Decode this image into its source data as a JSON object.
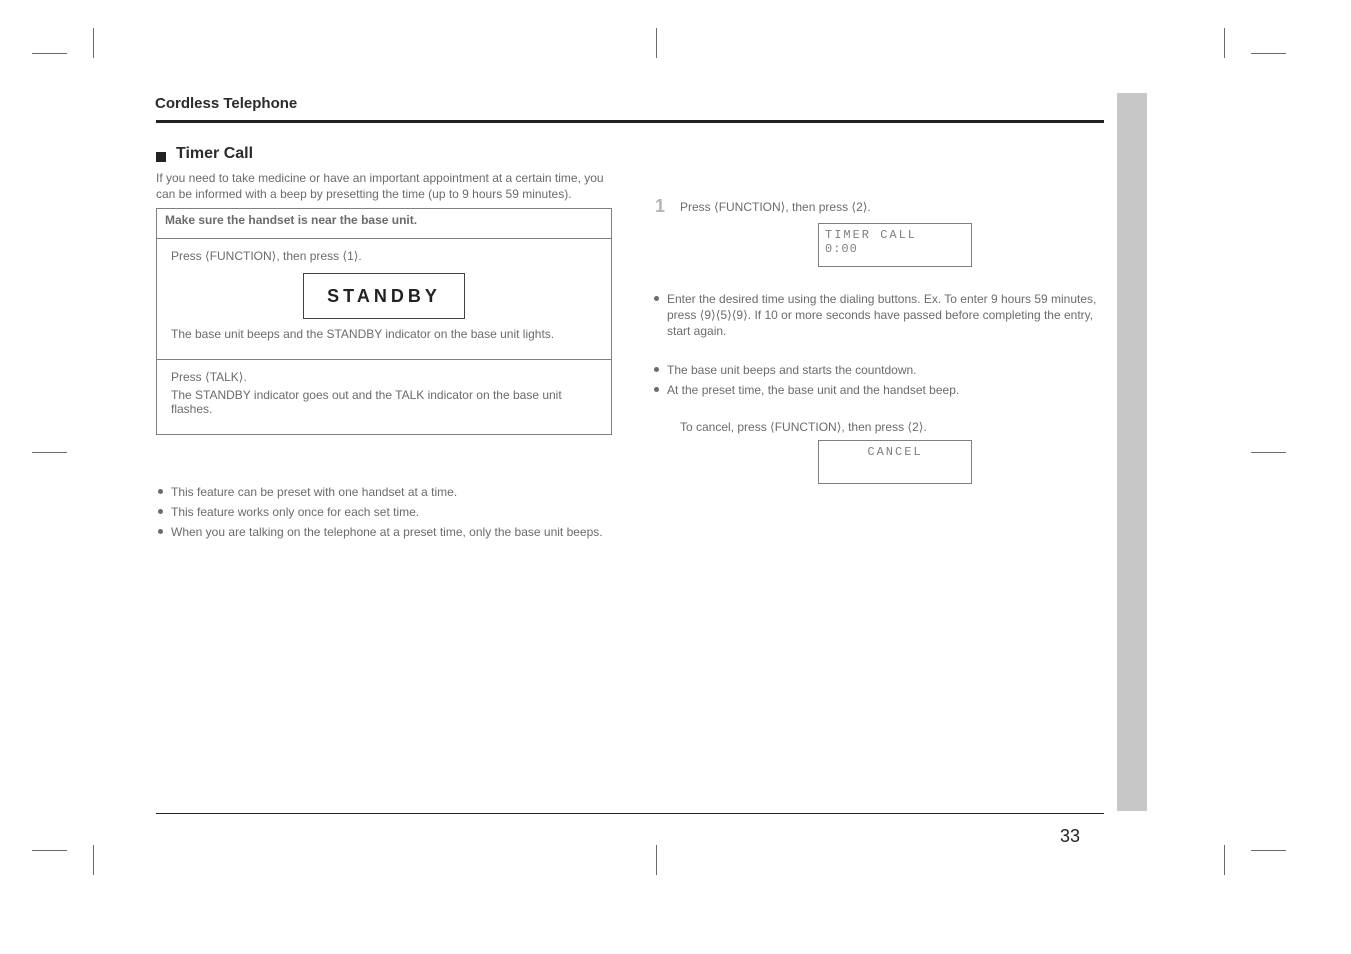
{
  "page": {
    "number": "33",
    "section_title": "Cordless Telephone",
    "headline": "Timer Call",
    "intro": "If you need to take medicine or have an important appointment at a certain time, you can be informed with a beep by presetting the time (up to 9 hours 59 minutes).",
    "bullets_after_box": [
      "This feature can be preset with one handset at a time.",
      "This feature works only once for each set time.",
      "When you are talking on the telephone at a preset time, only the base unit beeps."
    ],
    "info_box": {
      "header": "Make sure the handset is near the base unit.",
      "row2_line1": "Press ⟨FUNCTION⟩, then press ⟨1⟩.",
      "row2_inner": "STANDBY",
      "row2_after": "The base unit beeps and the STANDBY indicator on the base unit lights.",
      "row3_line1": "Press ⟨TALK⟩.",
      "row3_line2": "The STANDBY indicator goes out and the TALK indicator on the base unit flashes."
    }
  },
  "col2": {
    "step1_num": "1",
    "step1_text": "Press ⟨FUNCTION⟩, then press ⟨2⟩.",
    "lcd1_line1": "TIMER CALL",
    "lcd1_line2": "0:00",
    "b1": "Enter the desired time using the dialing buttons. Ex. To enter 9 hours 59 minutes, press ⟨9⟩⟨5⟩⟨9⟩. If 10 or more seconds have passed before completing the entry, start again.",
    "b2": "The base unit beeps and starts the countdown.",
    "b3": "At the preset time, the base unit and the handset beep.",
    "cancel_text": "To cancel, press ⟨FUNCTION⟩, then press ⟨2⟩.",
    "lcd2_line1": "CANCEL",
    "blank": "     "
  }
}
